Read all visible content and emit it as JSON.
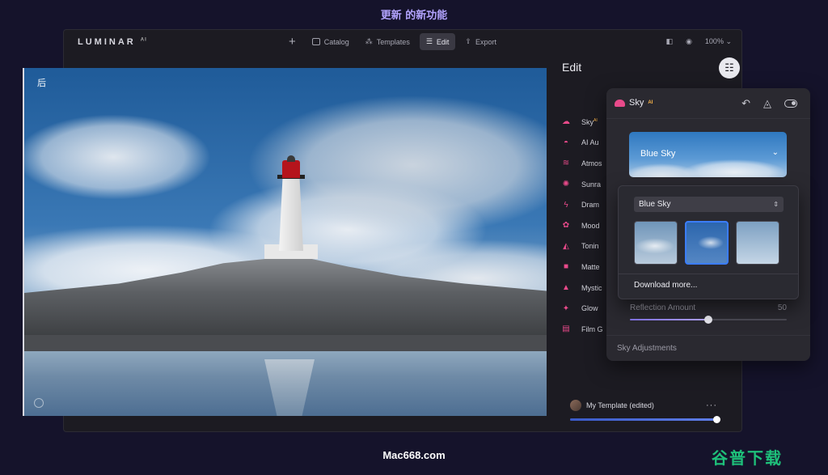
{
  "banner": {
    "text": "更新 的新功能"
  },
  "app": {
    "logo": "LUMINAR",
    "logo_sup": "AI",
    "nav": [
      {
        "label": "Catalog"
      },
      {
        "label": "Templates"
      },
      {
        "label": "Edit",
        "active": true
      },
      {
        "label": "Export"
      }
    ],
    "zoom": "100%"
  },
  "photo": {
    "before_label": "后"
  },
  "edit": {
    "title": "Edit",
    "tools": [
      {
        "label": "Sky",
        "sup": "AI",
        "icon": "cloud-icon"
      },
      {
        "label": "AI Au",
        "icon": "face-icon"
      },
      {
        "label": "Atmos",
        "icon": "waves-icon"
      },
      {
        "label": "Sunra",
        "icon": "sun-icon"
      },
      {
        "label": "Dram",
        "icon": "bolt-icon"
      },
      {
        "label": "Mood",
        "icon": "mood-icon"
      },
      {
        "label": "Tonin",
        "icon": "bucket-icon"
      },
      {
        "label": "Matte",
        "icon": "square-icon"
      },
      {
        "label": "Mystic",
        "icon": "mystic-icon"
      },
      {
        "label": "Glow",
        "icon": "sparkle-icon"
      },
      {
        "label": "Film G",
        "icon": "film-icon"
      }
    ]
  },
  "template": {
    "name": "My Template (edited)",
    "amount": 100
  },
  "sky_panel": {
    "title": "Sky",
    "title_sup": "AI",
    "preview_label": "Blue Sky",
    "dropdown": {
      "selected": "Blue Sky",
      "download_more": "Download more..."
    },
    "reflection_label": "Reflection Amount",
    "reflection_value": "50",
    "adjustments_label": "Sky Adjustments"
  },
  "footer": {
    "site": "Mac668.com",
    "brand": "谷普下载"
  },
  "colors": {
    "accent": "#e84a8a",
    "selection": "#3b7dff",
    "brand_green": "#1ec07a"
  }
}
